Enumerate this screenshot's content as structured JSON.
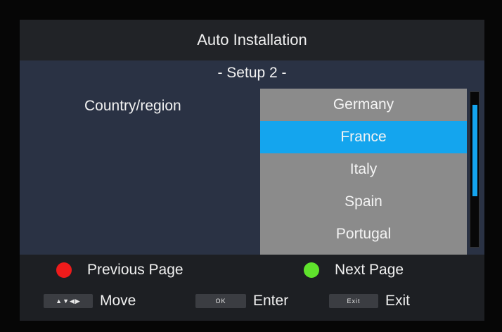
{
  "title": "Auto Installation",
  "subtitle": "- Setup 2 -",
  "field": {
    "label": "Country/region"
  },
  "country_list": {
    "items": [
      "Germany",
      "France",
      "Italy",
      "Spain",
      "Portugal"
    ],
    "selected": "France",
    "scroll_fraction": 0.3
  },
  "footer": {
    "previous": {
      "label": "Previous Page",
      "color": "#ee1b1b"
    },
    "next": {
      "label": "Next Page",
      "color": "#5fe22c"
    },
    "move": {
      "key": "▲▼◀▶",
      "label": "Move"
    },
    "enter": {
      "key": "OK",
      "label": "Enter"
    },
    "exit": {
      "key": "Exit",
      "label": "Exit"
    }
  },
  "colors": {
    "accent": "#14a5ee",
    "list_bg": "#8b8b8b",
    "panel_bg": "#2a3244"
  }
}
